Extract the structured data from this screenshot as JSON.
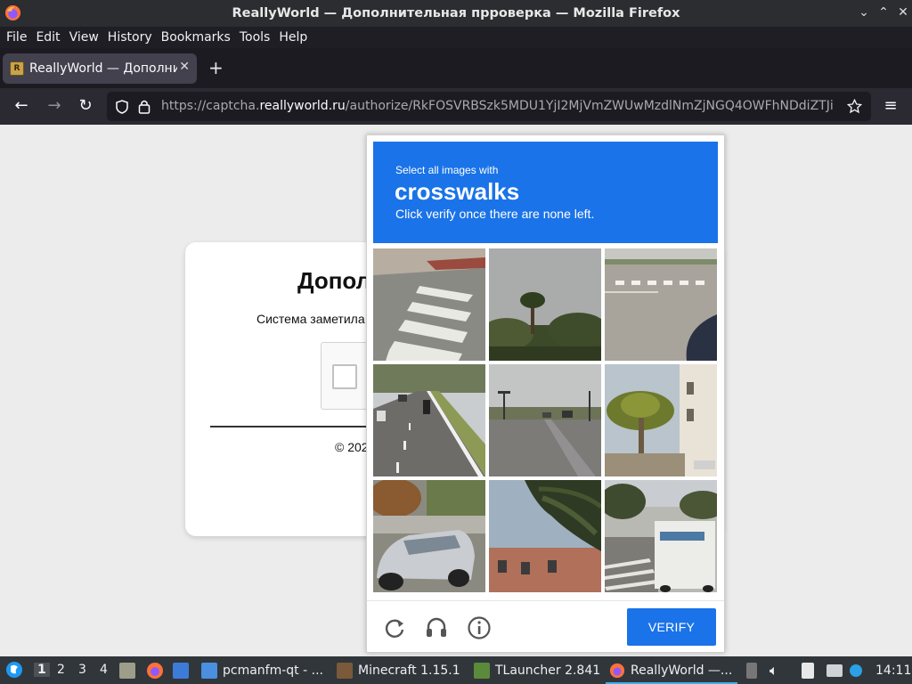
{
  "window": {
    "title": "ReallyWorld — Дополнительная прроверка — Mozilla Firefox",
    "controls": [
      "minimize",
      "maximize",
      "close"
    ]
  },
  "menu": {
    "items": [
      "File",
      "Edit",
      "View",
      "History",
      "Bookmarks",
      "Tools",
      "Help"
    ]
  },
  "tabs": [
    {
      "label": "ReallyWorld — Дополнительная прроверка",
      "active": true
    }
  ],
  "navbar": {
    "url_prefix": "https://captcha.",
    "url_host": "reallyworld.ru",
    "url_path": "/authorize/RkFOSVRBSzk5MDU1YjI2MjVmZWUwMzdlNmZjNGQ4OWFhNDdiZTJi"
  },
  "page": {
    "heading": "Допол",
    "subtitle": "Система заметила",
    "copyright": "© 202"
  },
  "captcha": {
    "select_text": "Select all images with",
    "target": "crosswalks",
    "instruction": "Click verify once there are none left.",
    "verify_label": "VERIFY",
    "tiles": [
      "crosswalk-lines",
      "palm-tree",
      "crosswalk-intersection",
      "road-motorcycle",
      "road-traffic-lights",
      "palm-building",
      "parked-car",
      "palm-building-close",
      "truck-crosswalk"
    ],
    "accent": "#1a73e8"
  },
  "taskbar": {
    "desktops": [
      "1",
      "2",
      "3",
      "4"
    ],
    "apps": [
      {
        "label": "pcmanfm-qt - ..."
      },
      {
        "label": "Minecraft 1.15.1"
      },
      {
        "label": "TLauncher 2.841"
      },
      {
        "label": "ReallyWorld —..."
      }
    ],
    "clock": "14:11"
  }
}
